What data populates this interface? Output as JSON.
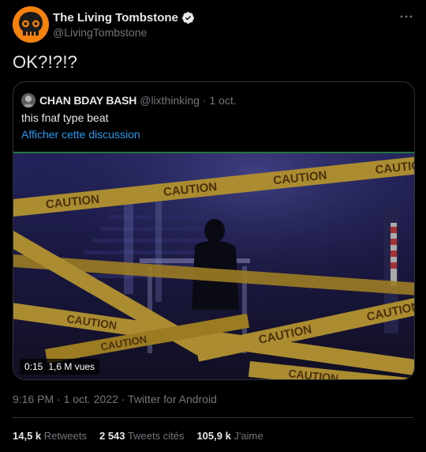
{
  "author": {
    "name": "The Living Tombstone",
    "handle": "@LivingTombstone",
    "avatar_icon": "skull-logo-icon",
    "avatar_color": "#f5820d",
    "verified": true
  },
  "tweet": {
    "text": "OK?!?!?",
    "timestamp": "9:16 PM · 1 oct. 2022 · Twitter for Android"
  },
  "quoted": {
    "name": "CHAN BDAY BASH",
    "handle_date": "@lixthinking · 1 oct.",
    "text": "this fnaf type beat",
    "link": "Afficher cette discussion",
    "video": {
      "duration": "0:15",
      "views": "1,6 M vues",
      "tape_text": "CAUTION"
    }
  },
  "stats": [
    {
      "value": "14,5 k",
      "label": "Retweets"
    },
    {
      "value": "2 543",
      "label": "Tweets cités"
    },
    {
      "value": "105,9 k",
      "label": "J'aime"
    }
  ],
  "colors": {
    "background": "#000000",
    "text": "#e7e9ea",
    "muted": "#71767b",
    "link": "#1d9bf0",
    "border": "#2f3336"
  }
}
